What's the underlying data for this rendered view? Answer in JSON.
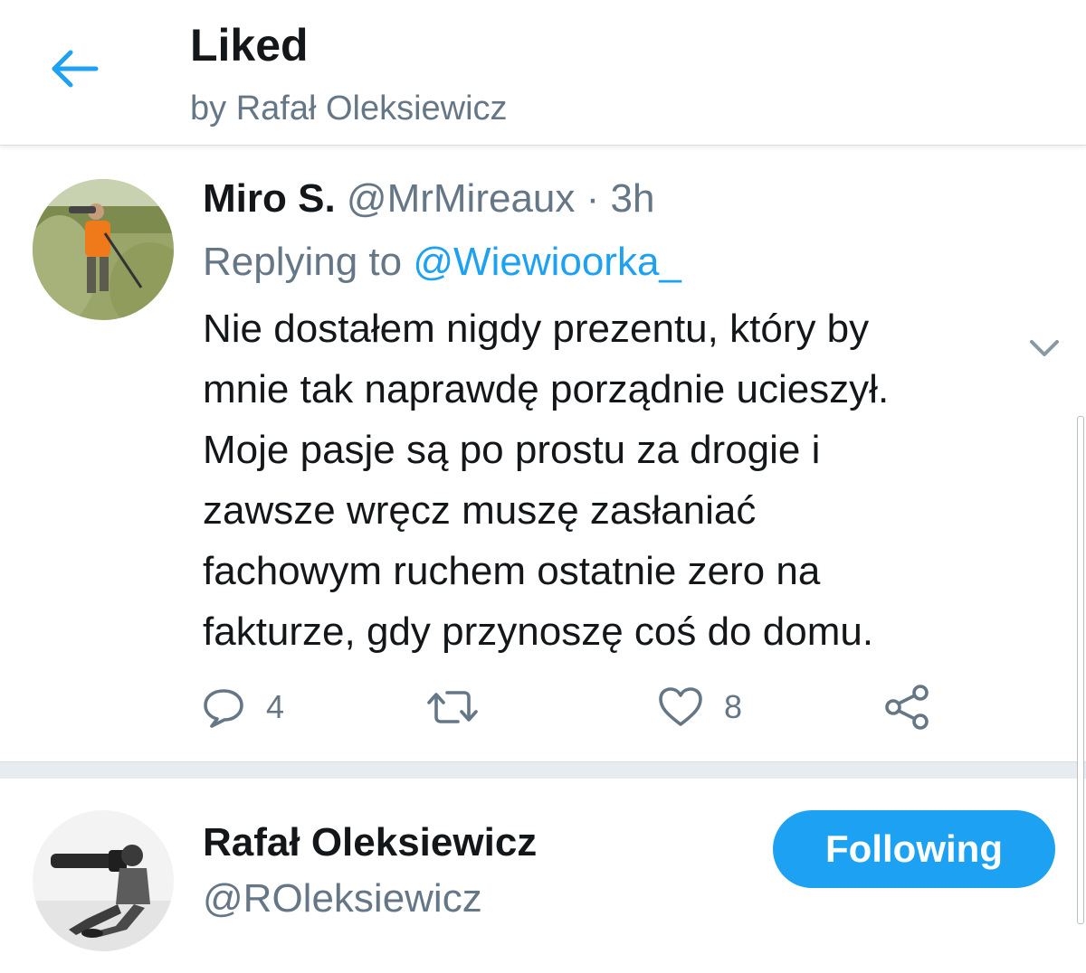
{
  "header": {
    "title": "Liked",
    "subtitle": "by Rafał Oleksiewicz",
    "back_icon": "arrow-left-icon"
  },
  "tweet": {
    "author_name": "Miro S.",
    "author_handle": "@MrMireaux",
    "separator": "·",
    "timestamp": "3h",
    "replying_prefix": "Replying to",
    "replying_to": "@Wiewioorka_",
    "text": "Nie dostałem nigdy prezentu, który by\nmnie tak naprawdę porządnie ucieszył.\nMoje pasje są po prostu za drogie i\nzawsze wręcz muszę zasłaniać\nfachowym ruchem ostatnie zero na\nfakturze, gdy przynoszę coś do domu.",
    "actions": {
      "reply_count": "4",
      "retweet_count": "",
      "like_count": "8"
    },
    "icons": {
      "reply": "reply-icon",
      "retweet": "retweet-icon",
      "like": "heart-icon",
      "share": "share-icon",
      "more": "chevron-down-icon"
    }
  },
  "profile": {
    "name": "Rafał Oleksiewicz",
    "handle": "@ROleksiewicz",
    "follow_label": "Following"
  },
  "colors": {
    "accent": "#1da1f2",
    "secondary_text": "#657786",
    "primary_text": "#14171a",
    "separator": "#e6ecf0"
  }
}
